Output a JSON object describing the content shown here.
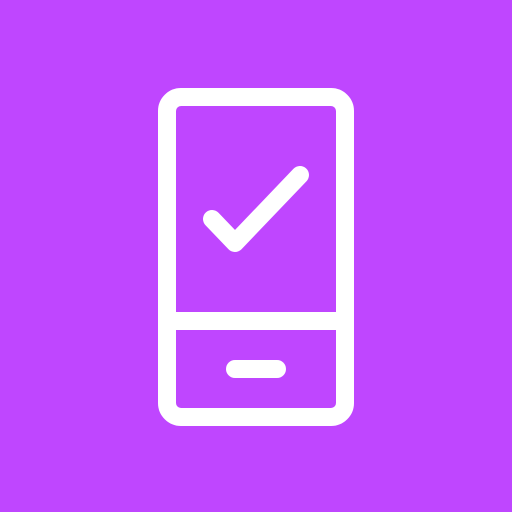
{
  "icon": {
    "name": "phone-check-icon",
    "background_color": "#BF46FF",
    "foreground_color": "#FFFFFF",
    "parts": [
      "phone-outline-icon",
      "check-icon",
      "home-button-icon"
    ]
  }
}
